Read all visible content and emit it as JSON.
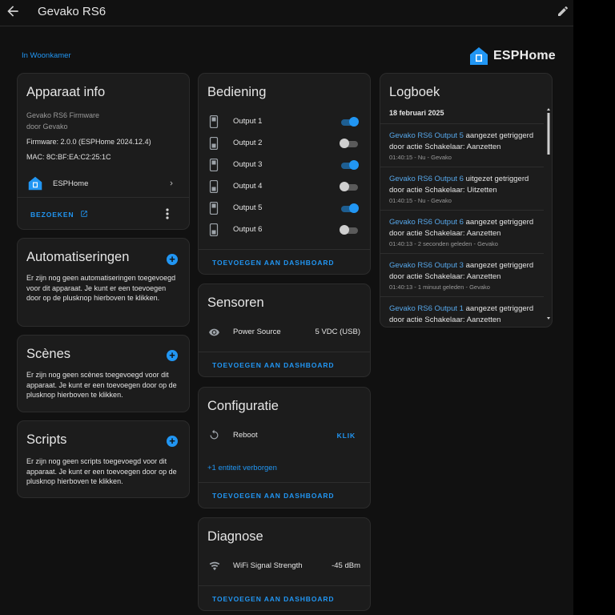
{
  "header": {
    "title": "Gevako RS6"
  },
  "area_link": "In Woonkamer",
  "brand": {
    "name": "ESPHome",
    "accent": "#2196f3"
  },
  "device_info": {
    "title": "Apparaat info",
    "firmware_line1": "Gevako RS6 Firmware",
    "firmware_line2": "door Gevako",
    "firmware": "Firmware: 2.0.0 (ESPHome 2024.12.4)",
    "mac": "MAC: 8C:BF:EA:C2:25:1C",
    "integration": "ESPHome",
    "visit": "BEZOEKEN"
  },
  "automations": {
    "title": "Automatiseringen",
    "text": "Er zijn nog geen automatiseringen toegevoegd voor dit apparaat. Je kunt er een toevoegen door op de plusknop hierboven te klikken."
  },
  "scenes": {
    "title": "Scènes",
    "text": "Er zijn nog geen scènes toegevoegd voor dit apparaat. Je kunt er een toevoegen door op de plusknop hierboven te klikken."
  },
  "scripts": {
    "title": "Scripts",
    "text": "Er zijn nog geen scripts toegevoegd voor dit apparaat. Je kunt er een toevoegen door op de plusknop hierboven te klikken."
  },
  "controls": {
    "title": "Bediening",
    "outputs": [
      {
        "label": "Output 1",
        "on": true
      },
      {
        "label": "Output 2",
        "on": false
      },
      {
        "label": "Output 3",
        "on": true
      },
      {
        "label": "Output 4",
        "on": false
      },
      {
        "label": "Output 5",
        "on": true
      },
      {
        "label": "Output 6",
        "on": false
      }
    ],
    "add": "TOEVOEGEN AAN DASHBOARD"
  },
  "sensors": {
    "title": "Sensoren",
    "label": "Power Source",
    "value": "5 VDC (USB)",
    "add": "TOEVOEGEN AAN DASHBOARD"
  },
  "configuration": {
    "title": "Configuratie",
    "label": "Reboot",
    "action": "KLIK",
    "hidden": "+1 entiteit verborgen",
    "add": "TOEVOEGEN AAN DASHBOARD"
  },
  "diagnostics": {
    "title": "Diagnose",
    "label": "WiFi Signal Strength",
    "value": "-45 dBm",
    "add": "TOEVOEGEN AAN DASHBOARD"
  },
  "logbook": {
    "title": "Logboek",
    "date": "18 februari 2025",
    "entries": [
      {
        "entity": "Gevako RS6 Output 5",
        "action": " aangezet getriggerd door actie Schakelaar: Aanzetten",
        "meta": "01:40:15 - Nu - Gevako"
      },
      {
        "entity": "Gevako RS6 Output 6",
        "action": " uitgezet getriggerd door actie Schakelaar: Uitzetten",
        "meta": "01:40:15 - Nu - Gevako"
      },
      {
        "entity": "Gevako RS6 Output 6",
        "action": " aangezet getriggerd door actie Schakelaar: Aanzetten",
        "meta": "01:40:13 - 2 seconden geleden - Gevako"
      },
      {
        "entity": "Gevako RS6 Output 3",
        "action": " aangezet getriggerd door actie Schakelaar: Aanzetten",
        "meta": "01:40:13 - 1 minuut geleden - Gevako"
      },
      {
        "entity": "Gevako RS6 Output 1",
        "action": " aangezet getriggerd door actie Schakelaar: Aanzetten",
        "meta": ""
      }
    ]
  }
}
